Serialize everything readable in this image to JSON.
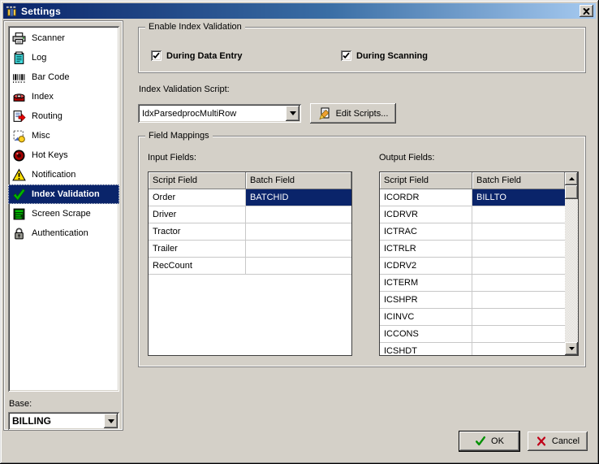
{
  "window": {
    "title": "Settings"
  },
  "sidebar": {
    "items": [
      {
        "label": "Scanner",
        "icon": "printer-icon",
        "selected": false
      },
      {
        "label": "Log",
        "icon": "log-icon",
        "selected": false
      },
      {
        "label": "Bar Code",
        "icon": "barcode-icon",
        "selected": false
      },
      {
        "label": "Index",
        "icon": "index-icon",
        "selected": false
      },
      {
        "label": "Routing",
        "icon": "routing-icon",
        "selected": false
      },
      {
        "label": "Misc",
        "icon": "misc-icon",
        "selected": false
      },
      {
        "label": "Hot Keys",
        "icon": "hotkeys-icon",
        "selected": false
      },
      {
        "label": "Notification",
        "icon": "notification-icon",
        "selected": false
      },
      {
        "label": "Index Validation",
        "icon": "green-check-icon",
        "selected": true
      },
      {
        "label": "Screen Scrape",
        "icon": "screen-icon",
        "selected": false
      },
      {
        "label": "Authentication",
        "icon": "lock-icon",
        "selected": false
      }
    ],
    "base": {
      "label": "Base:",
      "value": "BILLING"
    }
  },
  "enable_group": {
    "title": "Enable Index Validation",
    "checkboxes": [
      {
        "label": "During Data Entry",
        "checked": true
      },
      {
        "label": "During Scanning",
        "checked": true
      }
    ]
  },
  "script_section": {
    "label": "Index Validation Script:",
    "selected_script": "IdxParsedprocMultiRow",
    "edit_button_label": "Edit Scripts..."
  },
  "field_mappings": {
    "title": "Field Mappings",
    "input_fields": {
      "label": "Input Fields:",
      "headers": [
        "Script Field",
        "Batch Field"
      ],
      "rows": [
        [
          "Order",
          "BATCHID"
        ],
        [
          "Driver",
          ""
        ],
        [
          "Tractor",
          ""
        ],
        [
          "Trailer",
          ""
        ],
        [
          "RecCount",
          ""
        ]
      ],
      "selected": {
        "row": 0,
        "col": 1
      }
    },
    "output_fields": {
      "label": "Output Fields:",
      "headers": [
        "Script Field",
        "Batch Field"
      ],
      "rows": [
        [
          "ICORDR",
          "BILLTO"
        ],
        [
          "ICDRVR",
          ""
        ],
        [
          "ICTRAC",
          ""
        ],
        [
          "ICTRLR",
          ""
        ],
        [
          "ICDRV2",
          ""
        ],
        [
          "ICTERM",
          ""
        ],
        [
          "ICSHPR",
          ""
        ],
        [
          "ICINVC",
          ""
        ],
        [
          "ICCONS",
          ""
        ],
        [
          "ICSHDT",
          ""
        ]
      ],
      "selected": {
        "row": 0,
        "col": 1
      },
      "has_scrollbar": true
    }
  },
  "footer_buttons": {
    "ok": "OK",
    "cancel": "Cancel"
  },
  "colors": {
    "dialog_bg": "#D4D0C8",
    "titlebar_left": "#0A246A",
    "titlebar_right": "#A6CAF0",
    "selection_bg": "#0A246A",
    "selection_text": "#FFFFFF",
    "ok_check": "#009000",
    "cancel_x": "#C00018"
  }
}
